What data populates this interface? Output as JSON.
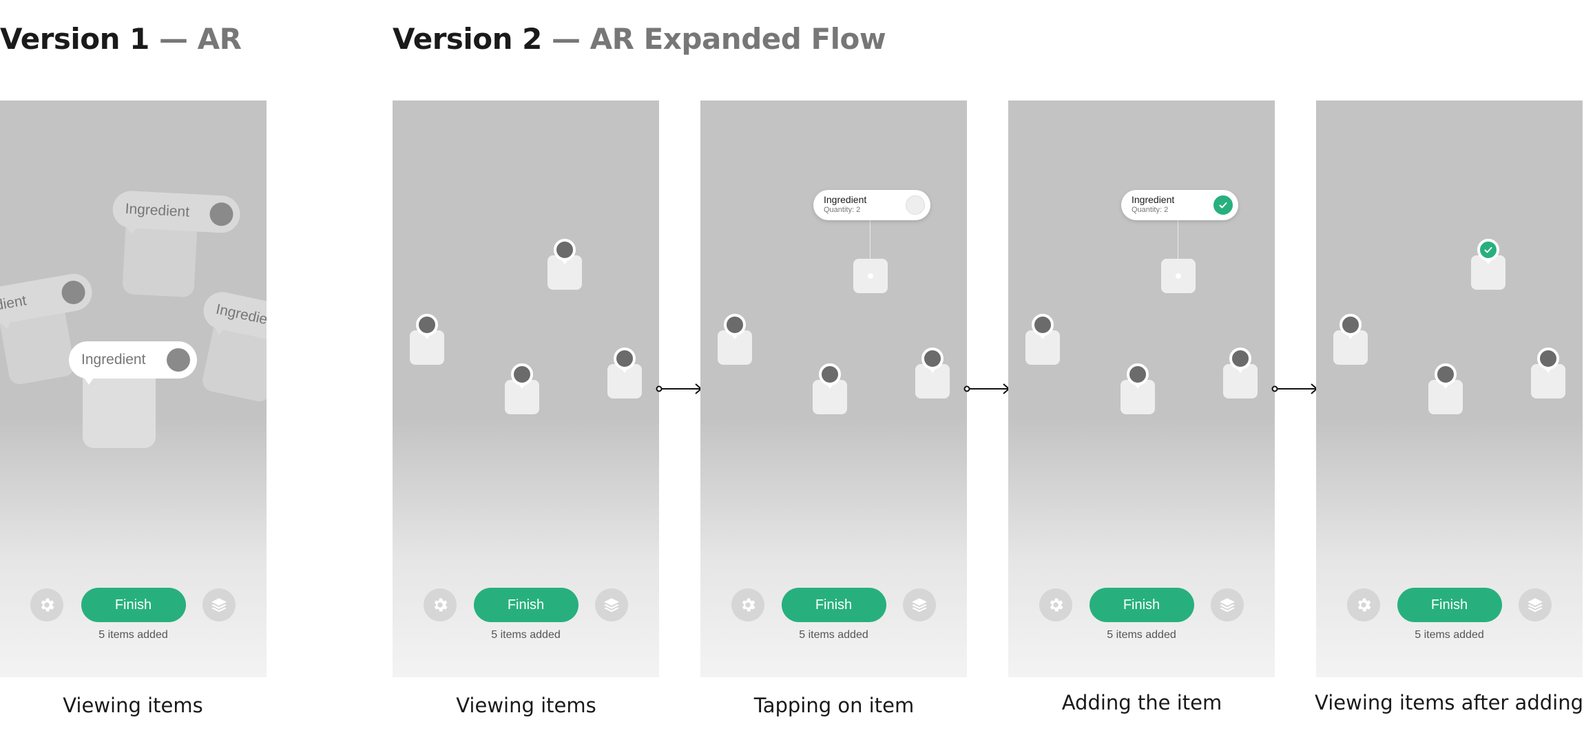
{
  "headings": {
    "v1_main": "Version 1",
    "v1_sub": "— AR",
    "v2_main": "Version 2",
    "v2_sub": "— AR Expanded Flow"
  },
  "screens": [
    {
      "caption": "Viewing items",
      "finish_label": "Finish",
      "count_label": "5 items added"
    },
    {
      "caption": "Viewing items",
      "finish_label": "Finish",
      "count_label": "5 items added"
    },
    {
      "caption": "Tapping on item",
      "finish_label": "Finish",
      "count_label": "5 items added"
    },
    {
      "caption": "Adding the item",
      "finish_label": "Finish",
      "count_label": "5 items added"
    },
    {
      "caption": "Viewing items after adding",
      "finish_label": "Finish",
      "count_label": "5 items added"
    }
  ],
  "ar_labels": [
    "Ingredient",
    "dient",
    "Ingredient",
    "Ingredie"
  ],
  "tooltip": {
    "title": "Ingredient",
    "quantity": "Quantity: 2"
  },
  "icons": {
    "left": "gear-icon",
    "right": "layers-icon",
    "added": "check-icon",
    "flow": "arrow-right-icon"
  },
  "colors": {
    "accent": "#27b07e",
    "pin": "#6b6b6b",
    "screen": "#c3c3c3"
  }
}
